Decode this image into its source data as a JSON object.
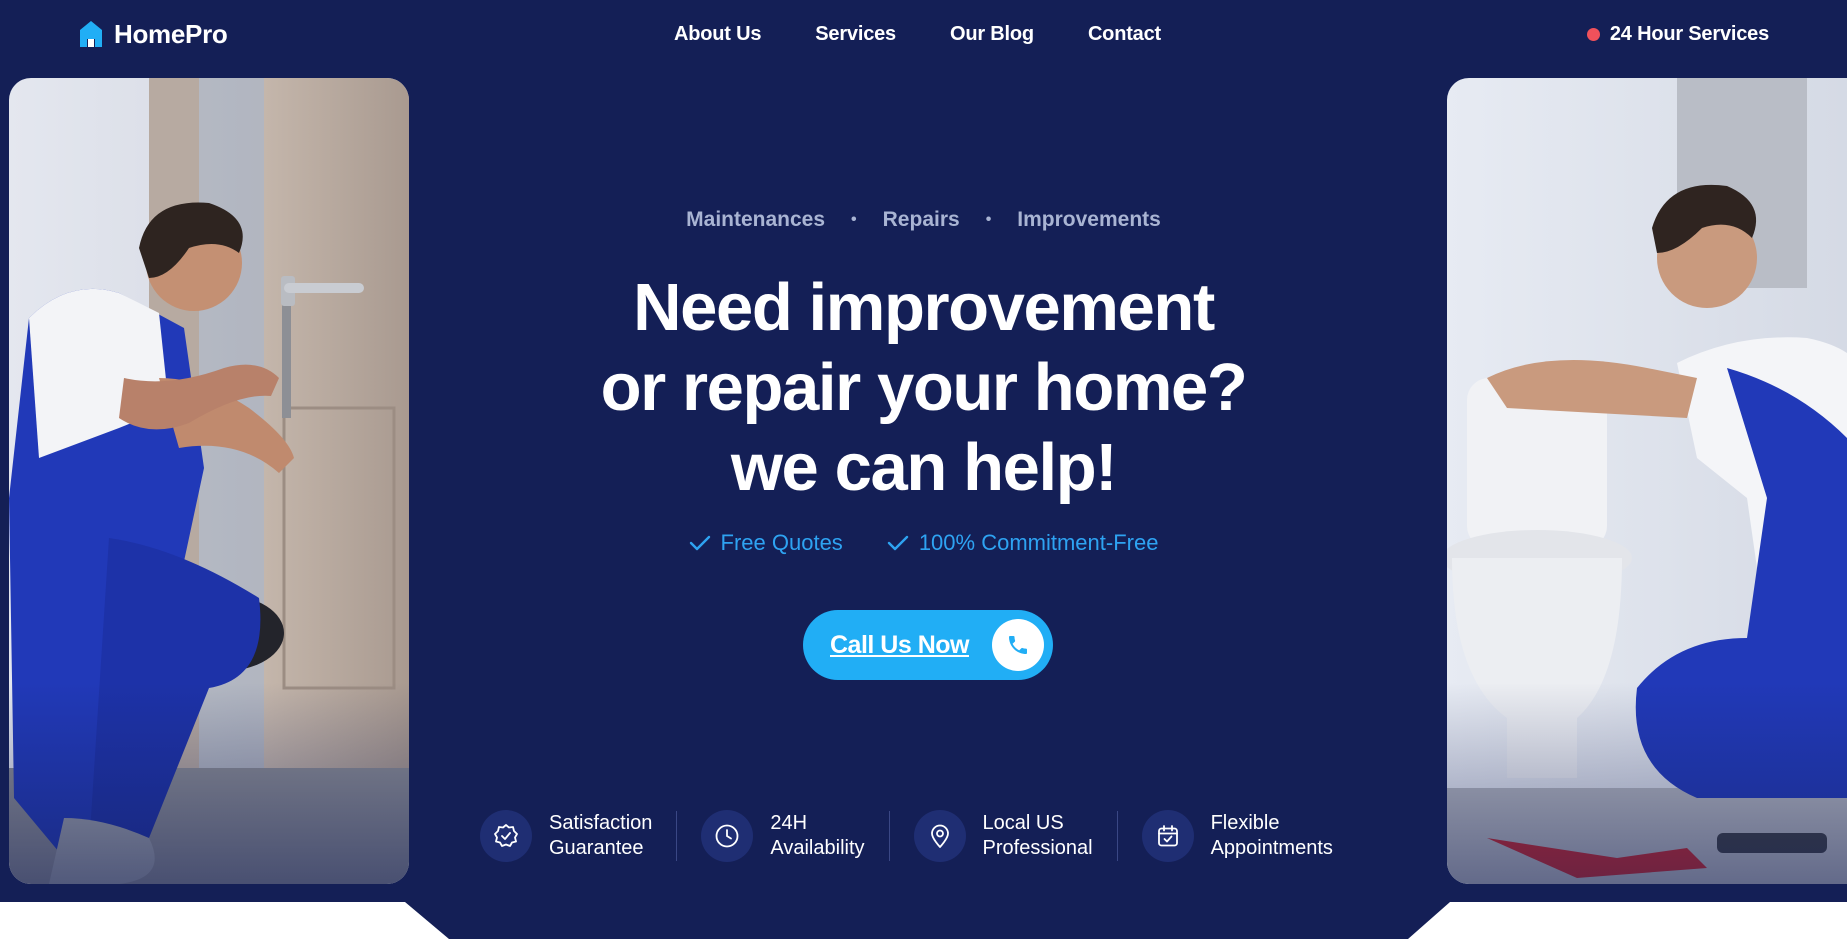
{
  "colors": {
    "background": "#141f56",
    "accent": "#21aef5",
    "accent_text": "#2ea3f2",
    "muted_text": "#a9b4d3",
    "icon_bg": "#1f2e73",
    "dot_red": "#f0515b"
  },
  "header": {
    "logo_text": "HomePro",
    "logo_icon": "house-icon",
    "nav": [
      {
        "label": "About Us"
      },
      {
        "label": "Services"
      },
      {
        "label": "Our Blog"
      },
      {
        "label": "Contact"
      }
    ],
    "hours_label": "24 Hour Services"
  },
  "hero": {
    "kicker": [
      "Maintenances",
      "Repairs",
      "Improvements"
    ],
    "kicker_separator": "•",
    "headline_lines": [
      "Need improvement",
      "or repair your home?",
      "we can help!"
    ],
    "checks": [
      "Free Quotes",
      "100% Commitment-Free"
    ],
    "cta_label": "Call Us Now",
    "cta_icon": "phone-icon"
  },
  "features": [
    {
      "icon": "badge-check-icon",
      "text": "Satisfaction\nGuarantee"
    },
    {
      "icon": "clock-icon",
      "text": "24H\nAvailability"
    },
    {
      "icon": "location-pin-icon",
      "text": "Local US\nProfessional"
    },
    {
      "icon": "calendar-check-icon",
      "text": "Flexible\nAppointments"
    }
  ]
}
